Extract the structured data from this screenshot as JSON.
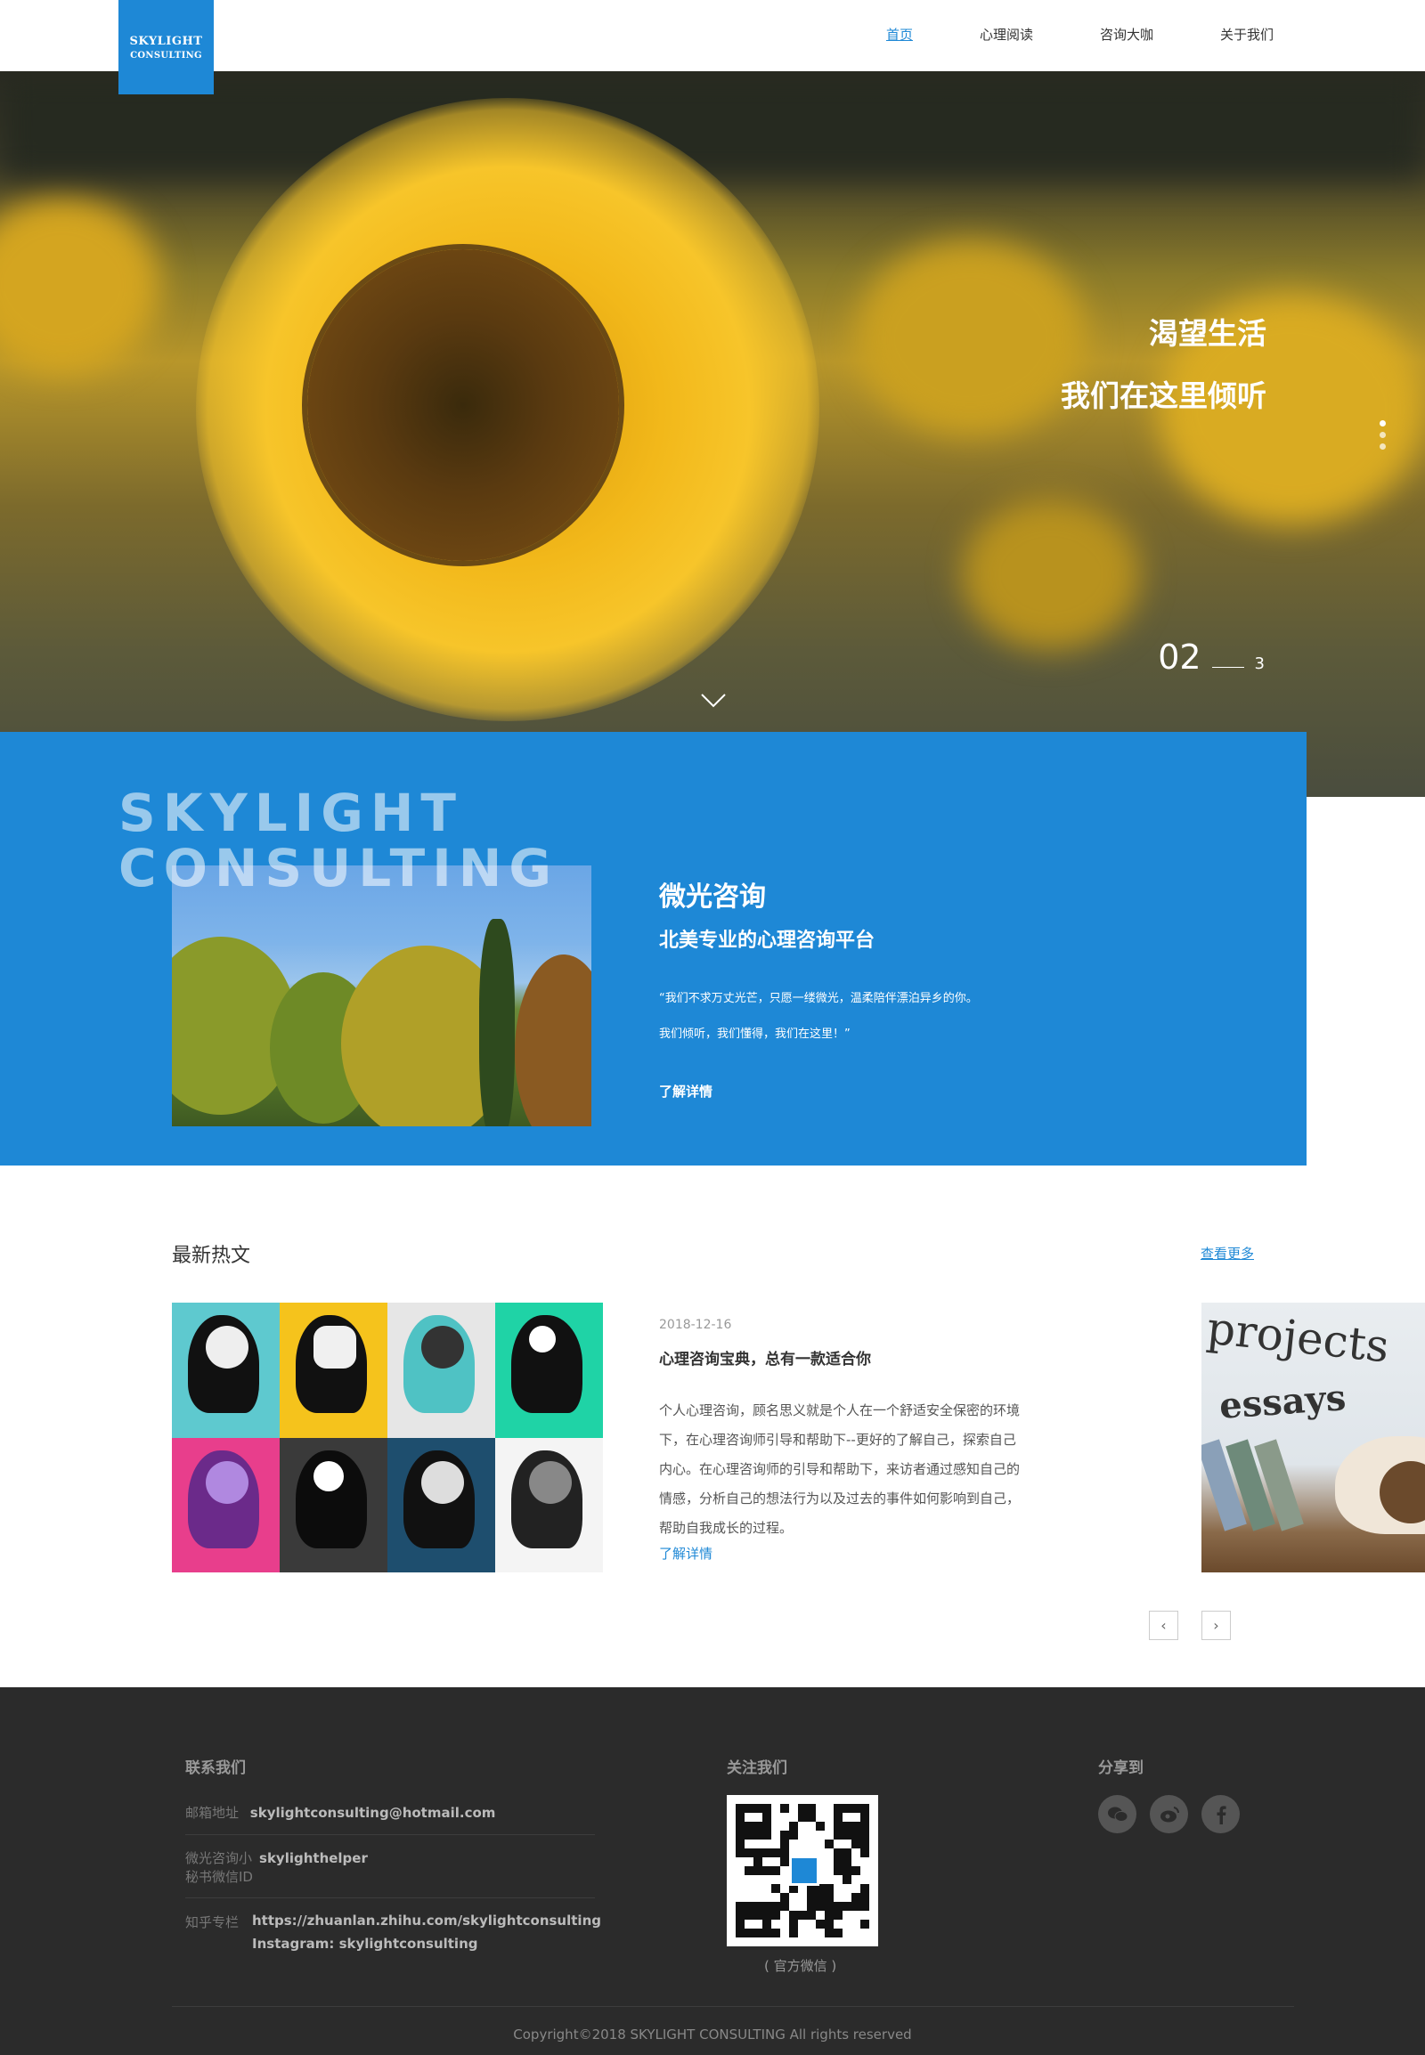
{
  "header": {
    "logo_line1": "SKYLIGHT",
    "logo_line2": "CONSULTING",
    "nav": [
      {
        "label": "首页",
        "active": true
      },
      {
        "label": "心理阅读",
        "active": false
      },
      {
        "label": "咨询大咖",
        "active": false
      },
      {
        "label": "关于我们",
        "active": false
      }
    ]
  },
  "hero": {
    "line1": "渴望生活",
    "line2": "我们在这里倾听",
    "slide_current": "02",
    "slide_total": "3",
    "down_arrow_icon": "chevron-down-icon"
  },
  "intro": {
    "brand_line1": "SKYLIGHT",
    "brand_line2": "CONSULTING",
    "title": "微光咨询",
    "subtitle": "北美专业的心理咨询平台",
    "quote1": "“我们不求万丈光芒，只愿一缕微光，温柔陪伴漂泊异乡的你。",
    "quote2": "我们倾听，我们懂得，我们在这里！”",
    "more": "了解详情"
  },
  "hot": {
    "title": "最新热文",
    "more": "查看更多",
    "article": {
      "date": "2018-12-16",
      "title": "心理咨询宝典，总有一款适合你",
      "body": "个人心理咨询，顾名思义就是个人在一个舒适安全保密的环境下，在心理咨询师引导和帮助下--更好的了解自己，探索自己内心。在心理咨询师的引导和帮助下，来访者通过感知自己的情感，分析自己的想法行为以及过去的事件如何影响到自己，帮助自我成长的过程。",
      "more": "了解详情"
    },
    "side_text1": "projects",
    "side_text2": "essays",
    "prev_icon": "‹",
    "next_icon": "›"
  },
  "footer": {
    "contact_title": "联系我们",
    "email_label": "邮箱地址",
    "email_value": "skylightconsulting@hotmail.com",
    "wechat_label1": "微光咨询小",
    "wechat_label2": "秘书微信ID",
    "wechat_value": "skylighthelper",
    "zhihu_label": "知乎专栏",
    "zhihu_value": "https://zhuanlan.zhihu.com/skylightconsulting",
    "instagram_value": "Instagram: skylightconsulting",
    "follow_title": "关注我们",
    "qr_caption": "( 官方微信 )",
    "share_title": "分享到",
    "share_icons": [
      "wechat-icon",
      "weibo-icon",
      "facebook-icon"
    ],
    "copyright": "Copyright©2018 SKYLIGHT CONSULTING All rights reserved"
  },
  "colors": {
    "brand_blue": "#1e88d6",
    "footer_bg": "#2b2b2b"
  }
}
